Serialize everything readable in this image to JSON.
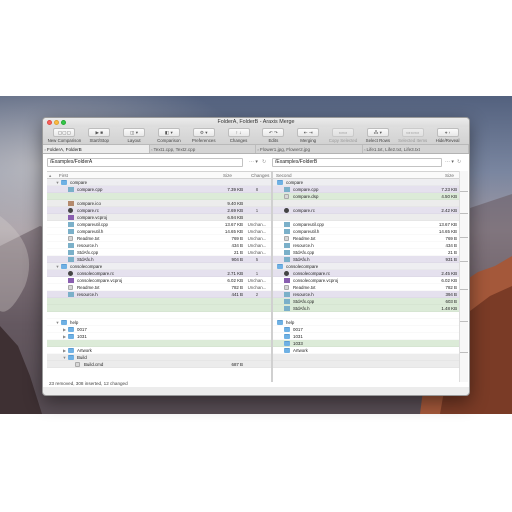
{
  "window": {
    "title": "FolderA, FolderB - Araxis Merge"
  },
  "toolbar": [
    {
      "label": "New Comparison",
      "icon": "new-comparison-icon"
    },
    {
      "label": "Start/Stop",
      "icon": "start-stop-icon"
    },
    {
      "label": "Layout",
      "icon": "layout-icon"
    },
    {
      "label": "Comparison",
      "icon": "comparison-icon"
    },
    {
      "label": "Preferences",
      "icon": "gear-icon"
    },
    {
      "label": "Changes",
      "icon": "changes-icon"
    },
    {
      "label": "Edits",
      "icon": "edits-icon"
    },
    {
      "label": "Merging",
      "icon": "merging-icon"
    },
    {
      "label": "Copy Selected",
      "icon": "copy-selected-icon"
    },
    {
      "label": "Select Rows",
      "icon": "select-rows-icon"
    },
    {
      "label": "Selected Items",
      "icon": "selected-items-icon"
    },
    {
      "label": "Hide/Reveal",
      "icon": "hide-reveal-icon"
    }
  ],
  "tabs": [
    {
      "label": "FolderA, FolderB",
      "active": true
    },
    {
      "label": "Text1.cpp, Text2.cpp",
      "active": false
    },
    {
      "label": "Flower1.jpg, Flower2.jpg",
      "active": false
    },
    {
      "label": "Life1.txt, Life2.txt, Life3.txt",
      "active": false
    }
  ],
  "left": {
    "path": "/Examples/FolderA",
    "headers": {
      "name": "First",
      "size": "Size",
      "changes": "Changes"
    },
    "rows": [
      {
        "name": "compare",
        "kind": "folder",
        "state": "folder",
        "level": 1,
        "toggle": "▼",
        "size": "",
        "changes": ""
      },
      {
        "name": "compare.cpp",
        "kind": "cpp",
        "state": "changed",
        "level": 2,
        "size": "7.39 KB",
        "changes": "8"
      },
      {
        "name": "",
        "kind": "",
        "state": "inserted",
        "level": 2,
        "size": "",
        "changes": ""
      },
      {
        "name": "compare.ico",
        "kind": "img",
        "state": "removed",
        "level": 2,
        "size": "9.40 KB",
        "changes": ""
      },
      {
        "name": "compare.rc",
        "kind": "rc",
        "state": "changed",
        "level": 2,
        "size": "2.69 KB",
        "changes": "1"
      },
      {
        "name": "compare.vcproj",
        "kind": "vc",
        "state": "removed",
        "level": 2,
        "size": "6.94 KB",
        "changes": ""
      },
      {
        "name": "compareutil.cpp",
        "kind": "cpp",
        "state": "empty",
        "level": 2,
        "size": "13.67 KB",
        "changes": "Unchan..."
      },
      {
        "name": "compareutil.h",
        "kind": "cpp",
        "state": "empty",
        "level": 2,
        "size": "14.65 KB",
        "changes": "Unchan..."
      },
      {
        "name": "Readme.txt",
        "kind": "txt",
        "state": "empty",
        "level": 2,
        "size": "769 B",
        "changes": "Unchan..."
      },
      {
        "name": "resource.h",
        "kind": "cpp",
        "state": "empty",
        "level": 2,
        "size": "434 B",
        "changes": "Unchan..."
      },
      {
        "name": "StdAfx.cpp",
        "kind": "cpp",
        "state": "empty",
        "level": 2,
        "size": "21 B",
        "changes": "Unchan..."
      },
      {
        "name": "StdAfx.h",
        "kind": "cpp",
        "state": "changed",
        "level": 2,
        "size": "904 B",
        "changes": "5"
      },
      {
        "name": "consolecompare",
        "kind": "folder",
        "state": "folder",
        "level": 1,
        "toggle": "▼",
        "size": "",
        "changes": ""
      },
      {
        "name": "consolecompare.rc",
        "kind": "rc",
        "state": "changed",
        "level": 2,
        "size": "2.71 KB",
        "changes": "1"
      },
      {
        "name": "consolecompare.vcproj",
        "kind": "vc",
        "state": "empty",
        "level": 2,
        "size": "6.02 KB",
        "changes": "Unchan..."
      },
      {
        "name": "Readme.txt",
        "kind": "txt",
        "state": "empty",
        "level": 2,
        "size": "782 B",
        "changes": "Unchan..."
      },
      {
        "name": "resource.h",
        "kind": "cpp",
        "state": "changed",
        "level": 2,
        "size": "441 B",
        "changes": "2"
      },
      {
        "name": "",
        "kind": "",
        "state": "inserted",
        "level": 2,
        "size": "",
        "changes": ""
      },
      {
        "name": "",
        "kind": "",
        "state": "inserted",
        "level": 2,
        "size": "",
        "changes": ""
      },
      {
        "name": "",
        "kind": "",
        "state": "empty",
        "level": 2,
        "size": "",
        "changes": ""
      },
      {
        "name": "help",
        "kind": "folder",
        "state": "empty",
        "level": 1,
        "toggle": "▼",
        "size": "",
        "changes": ""
      },
      {
        "name": "0017",
        "kind": "folder",
        "state": "empty",
        "level": 2,
        "toggle": "▶",
        "size": "",
        "changes": ""
      },
      {
        "name": "1031",
        "kind": "folder",
        "state": "empty",
        "level": 2,
        "toggle": "▶",
        "size": "",
        "changes": ""
      },
      {
        "name": "",
        "kind": "",
        "state": "inserted",
        "level": 2,
        "size": "",
        "changes": ""
      },
      {
        "name": "Artwork",
        "kind": "folder",
        "state": "empty",
        "level": 2,
        "toggle": "▶",
        "size": "",
        "changes": ""
      },
      {
        "name": "Build",
        "kind": "folder",
        "state": "removed",
        "level": 2,
        "toggle": "▼",
        "size": "",
        "changes": ""
      },
      {
        "name": "Build.cmd",
        "kind": "txt",
        "state": "removed",
        "level": 3,
        "size": "687 B",
        "changes": ""
      }
    ]
  },
  "right": {
    "path": "/Examples/FolderB",
    "headers": {
      "name": "Second",
      "size": "Size"
    },
    "rows": [
      {
        "name": "compare",
        "kind": "folder",
        "state": "folder",
        "level": 1,
        "size": ""
      },
      {
        "name": "compare.cpp",
        "kind": "cpp",
        "state": "changed",
        "level": 2,
        "size": "7.23 KB"
      },
      {
        "name": "compare.dsp",
        "kind": "txt",
        "state": "inserted",
        "level": 2,
        "size": "4.50 KB"
      },
      {
        "name": "",
        "kind": "",
        "state": "removed",
        "level": 2,
        "size": ""
      },
      {
        "name": "compare.rc",
        "kind": "rc",
        "state": "changed",
        "level": 2,
        "size": "2.42 KB"
      },
      {
        "name": "",
        "kind": "",
        "state": "removed",
        "level": 2,
        "size": ""
      },
      {
        "name": "compareutil.cpp",
        "kind": "cpp",
        "state": "empty",
        "level": 2,
        "size": "13.67 KB"
      },
      {
        "name": "compareutil.h",
        "kind": "cpp",
        "state": "empty",
        "level": 2,
        "size": "14.65 KB"
      },
      {
        "name": "Readme.txt",
        "kind": "txt",
        "state": "empty",
        "level": 2,
        "size": "769 B"
      },
      {
        "name": "resource.h",
        "kind": "cpp",
        "state": "empty",
        "level": 2,
        "size": "434 B"
      },
      {
        "name": "StdAfx.cpp",
        "kind": "cpp",
        "state": "empty",
        "level": 2,
        "size": "21 B"
      },
      {
        "name": "StdAfx.h",
        "kind": "cpp",
        "state": "changed",
        "level": 2,
        "size": "931 B"
      },
      {
        "name": "consolecompare",
        "kind": "folder",
        "state": "folder",
        "level": 1,
        "size": ""
      },
      {
        "name": "consolecompare.rc",
        "kind": "rc",
        "state": "changed",
        "level": 2,
        "size": "2.45 KB"
      },
      {
        "name": "consolecompare.vcproj",
        "kind": "vc",
        "state": "empty",
        "level": 2,
        "size": "6.02 KB"
      },
      {
        "name": "Readme.txt",
        "kind": "txt",
        "state": "empty",
        "level": 2,
        "size": "782 B"
      },
      {
        "name": "resource.h",
        "kind": "cpp",
        "state": "changed",
        "level": 2,
        "size": "394 B"
      },
      {
        "name": "StdAfx.cpp",
        "kind": "cpp",
        "state": "inserted",
        "level": 2,
        "size": "603 B"
      },
      {
        "name": "StdAfx.h",
        "kind": "cpp",
        "state": "inserted",
        "level": 2,
        "size": "1.48 KB"
      },
      {
        "name": "",
        "kind": "",
        "state": "empty",
        "level": 2,
        "size": ""
      },
      {
        "name": "help",
        "kind": "folder",
        "state": "empty",
        "level": 1,
        "size": ""
      },
      {
        "name": "0017",
        "kind": "folder",
        "state": "empty",
        "level": 2,
        "size": ""
      },
      {
        "name": "1031",
        "kind": "folder",
        "state": "empty",
        "level": 2,
        "size": ""
      },
      {
        "name": "1033",
        "kind": "folder",
        "state": "inserted",
        "level": 2,
        "size": ""
      },
      {
        "name": "Artwork",
        "kind": "folder",
        "state": "empty",
        "level": 2,
        "size": ""
      },
      {
        "name": "",
        "kind": "",
        "state": "removed",
        "level": 2,
        "size": ""
      },
      {
        "name": "",
        "kind": "",
        "state": "removed",
        "level": 3,
        "size": ""
      }
    ]
  },
  "status": "23 removed, 308 inserted, 12 changed",
  "colors": {
    "changed": "#e5e1ee",
    "inserted": "#dcebd8",
    "removed": "#ececec",
    "folder_icon": "#6fb1e4"
  }
}
